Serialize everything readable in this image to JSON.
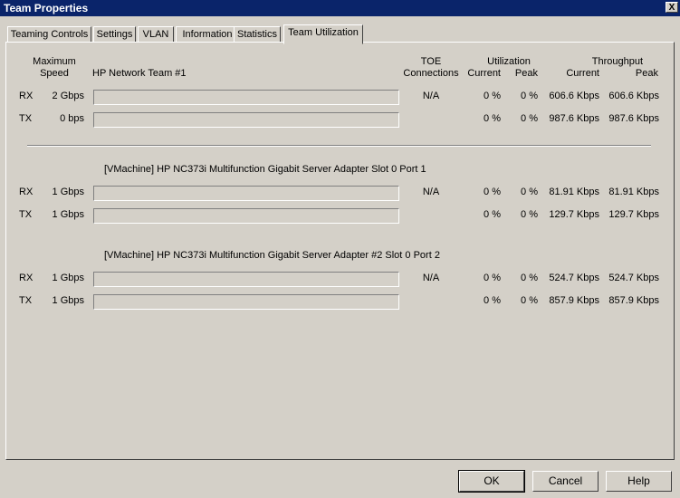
{
  "window": {
    "title": "Team Properties",
    "close_glyph": "X"
  },
  "tabs": [
    {
      "label": "Teaming Controls"
    },
    {
      "label": "Settings"
    },
    {
      "label": "VLAN"
    },
    {
      "label": "Information"
    },
    {
      "label": "Statistics"
    },
    {
      "label": "Team Utilization",
      "active": true
    }
  ],
  "headers": {
    "speed_line1": "Maximum",
    "speed_line2": "Speed",
    "toe_line1": "TOE",
    "toe_line2": "Connections",
    "utilization": "Utilization",
    "util_current": "Current",
    "util_peak": "Peak",
    "throughput": "Throughput",
    "thru_current": "Current",
    "thru_peak": "Peak"
  },
  "team": {
    "name": "HP Network Team #1",
    "rx": {
      "dir": "RX",
      "speed": "2 Gbps",
      "usage": 0,
      "toe": "N/A",
      "util_current": "0 %",
      "util_peak": "0 %",
      "thru_current": "606.6 Kbps",
      "thru_peak": "606.6 Kbps"
    },
    "tx": {
      "dir": "TX",
      "speed": "0 bps",
      "usage": 0,
      "util_current": "0 %",
      "util_peak": "0 %",
      "thru_current": "987.6 Kbps",
      "thru_peak": "987.6 Kbps"
    }
  },
  "adapters": [
    {
      "name": "[VMachine] HP NC373i Multifunction Gigabit Server Adapter Slot 0 Port 1",
      "rx": {
        "dir": "RX",
        "speed": "1 Gbps",
        "usage": 0,
        "toe": "N/A",
        "util_current": "0 %",
        "util_peak": "0 %",
        "thru_current": "81.91 Kbps",
        "thru_peak": "81.91 Kbps"
      },
      "tx": {
        "dir": "TX",
        "speed": "1 Gbps",
        "usage": 0,
        "util_current": "0 %",
        "util_peak": "0 %",
        "thru_current": "129.7 Kbps",
        "thru_peak": "129.7 Kbps"
      }
    },
    {
      "name": "[VMachine] HP NC373i Multifunction Gigabit Server Adapter #2 Slot 0 Port 2",
      "rx": {
        "dir": "RX",
        "speed": "1 Gbps",
        "usage": 0,
        "toe": "N/A",
        "util_current": "0 %",
        "util_peak": "0 %",
        "thru_current": "524.7 Kbps",
        "thru_peak": "524.7 Kbps"
      },
      "tx": {
        "dir": "TX",
        "speed": "1 Gbps",
        "usage": 0,
        "util_current": "0 %",
        "util_peak": "0 %",
        "thru_current": "857.9 Kbps",
        "thru_peak": "857.9 Kbps"
      }
    }
  ],
  "buttons": {
    "ok": "OK",
    "cancel": "Cancel",
    "help": "Help"
  },
  "colors": {
    "titlebar": "#0a246a",
    "face": "#d4d0c8",
    "bar_fill": "#0a246a"
  }
}
